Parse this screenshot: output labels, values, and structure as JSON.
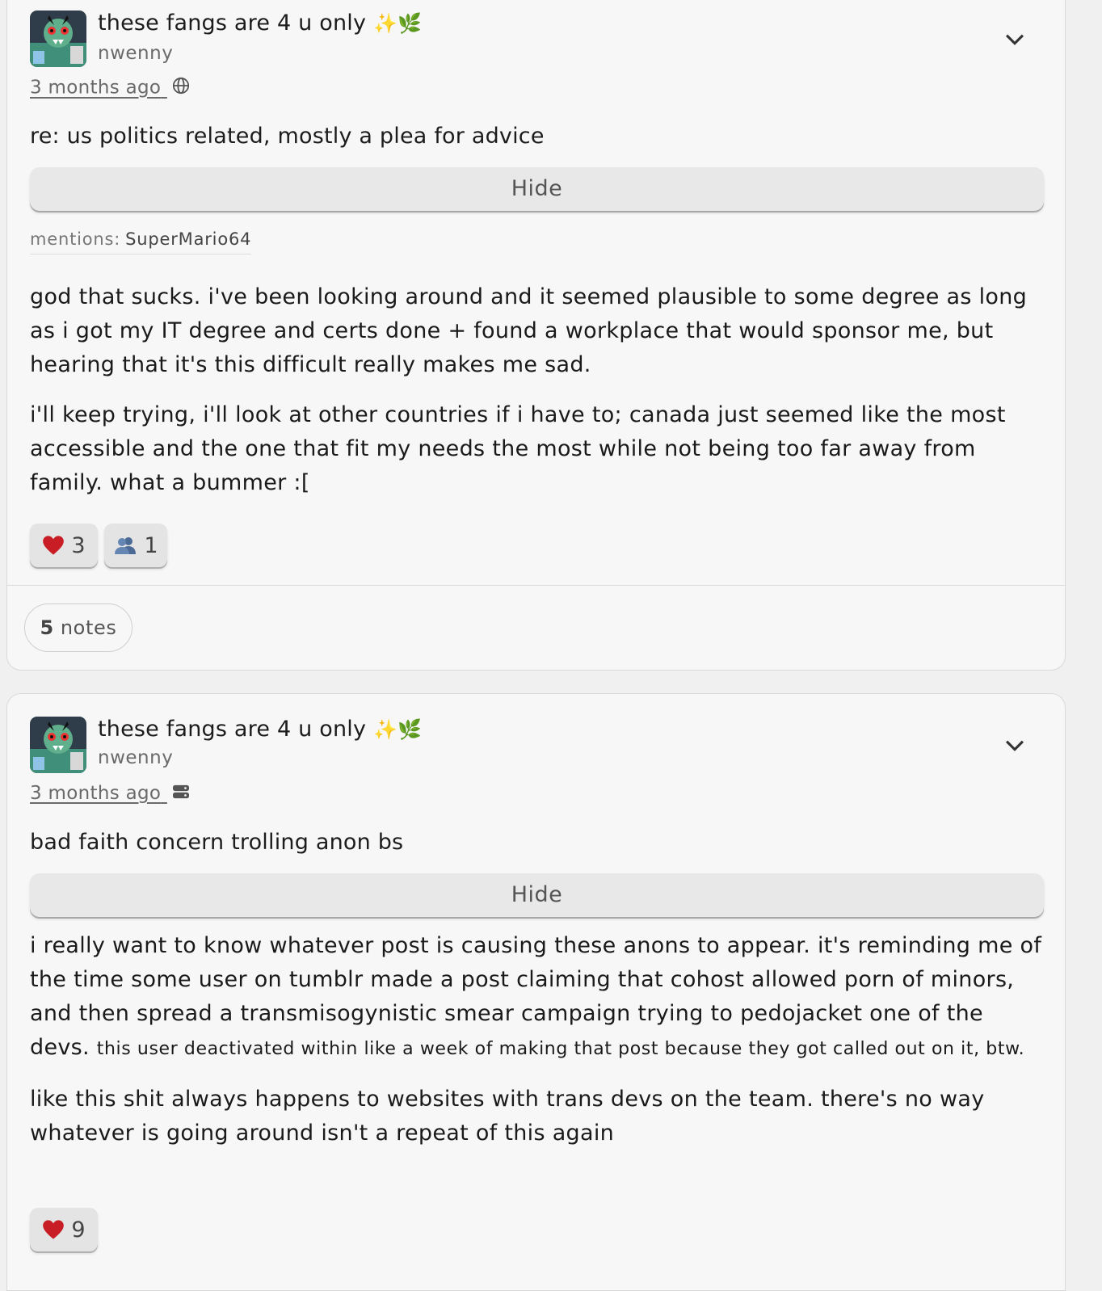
{
  "posts": [
    {
      "display_name": "these fangs are 4 u only",
      "emoji": "✨🌿",
      "handle": "nwenny",
      "time": "3 months ago",
      "visibility_icon": "globe-icon",
      "cw": "re: us politics related, mostly a plea for advice",
      "hide_label": "Hide",
      "mentions_label": "mentions:",
      "mentions_user": "SuperMario64",
      "paragraphs": [
        "god that sucks. i've been looking around and it seemed plausible to some degree as long as i got my IT degree and certs done + found a workplace that would sponsor me, but hearing that it's this difficult really makes me sad.",
        "i'll keep trying, i'll look at other countries if i have to; canada just seemed like the most accessible and the one that fit my needs the most while not being too far away from family. what a bummer :["
      ],
      "reactions": [
        {
          "icon": "heart-icon",
          "count": "3"
        },
        {
          "icon": "people-icon",
          "count": "1"
        }
      ],
      "notes_count": "5",
      "notes_label": "notes"
    },
    {
      "display_name": "these fangs are 4 u only",
      "emoji": "✨🌿",
      "handle": "nwenny",
      "time": "3 months ago",
      "visibility_icon": "server-icon",
      "cw": "bad faith concern trolling anon bs",
      "hide_label": "Hide",
      "paragraph1_main": "i really want to know whatever post is causing these anons to appear. it's reminding me of the time some user on tumblr made a post claiming that cohost allowed porn of minors, and then spread a transmisogynistic smear campaign trying to pedojacket one of the devs.",
      "paragraph1_small": "this user deactivated within like a week of making that post because they got called out on it, btw.",
      "paragraph2": "like this shit always happens to websites with trans devs on the team. there's no way whatever is going around isn't a repeat of this again",
      "reactions": [
        {
          "icon": "heart-icon",
          "count": "9"
        }
      ]
    }
  ]
}
